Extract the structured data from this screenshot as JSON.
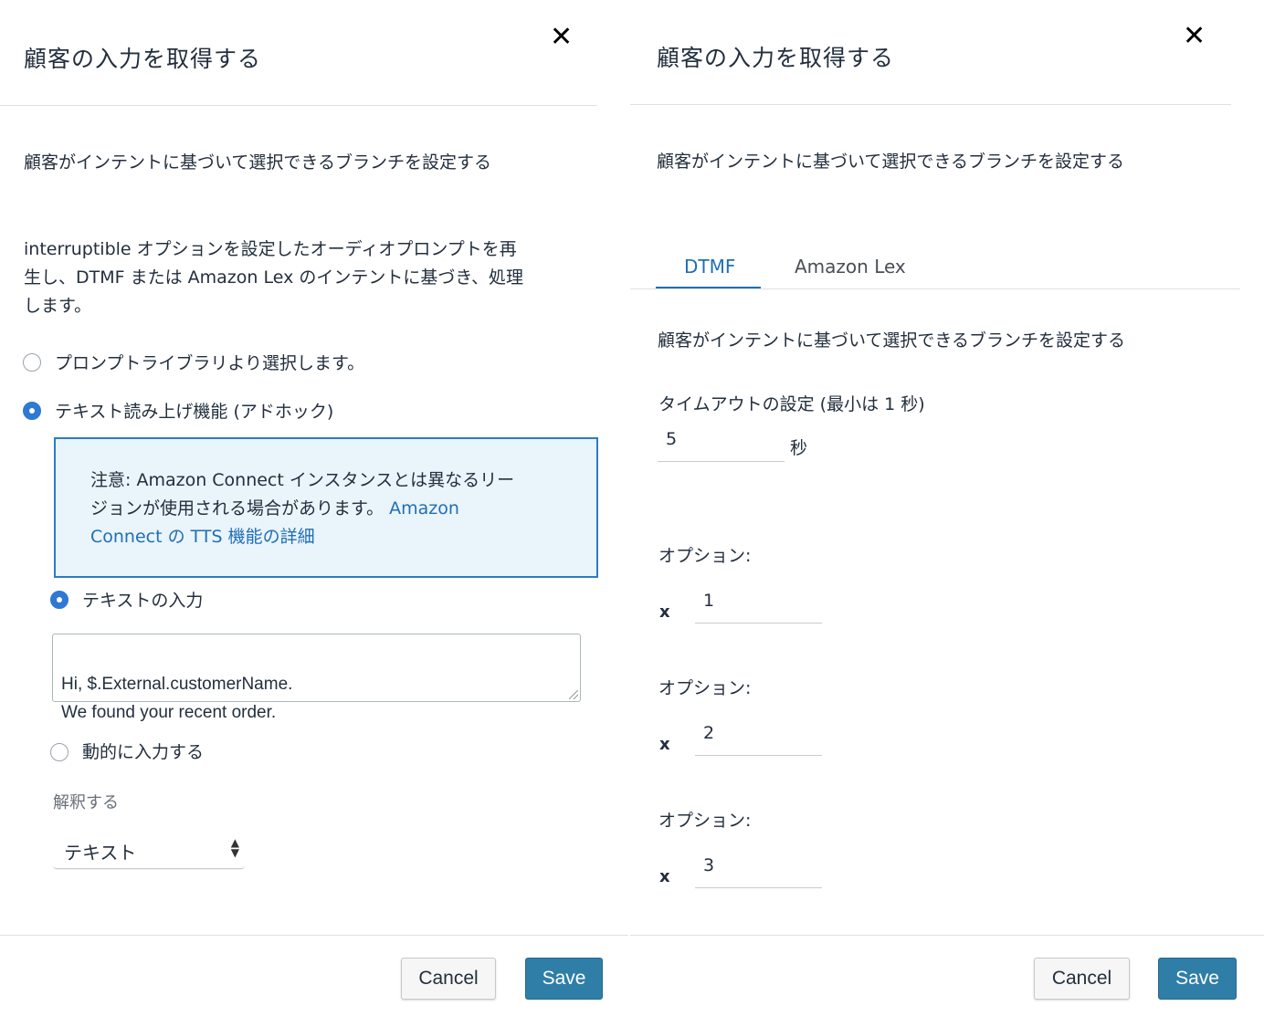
{
  "left": {
    "title": "顧客の入力を取得する",
    "close_label": "✕",
    "subtitle": "顧客がインテントに基づいて選択できるブランチを設定する",
    "description_lines": [
      "interruptible オプションを設定したオーディオプロンプトを再",
      "生し、DTMF または Amazon Lex のインテントに基づき、処理",
      "します。"
    ],
    "radio_library_label": "プロンプトライブラリより選択します。",
    "radio_tts_label": "テキスト読み上げ機能 (アドホック)",
    "notice": {
      "text_line1": "注意: Amazon Connect インスタンスとは異なるリー",
      "text_line2": "ジョンが使用される場合があります。",
      "link_line2": "Amazon",
      "link_line3": "Connect の TTS 機能の詳細"
    },
    "radio_text_input_label": "テキストの入力",
    "textarea_value": "Hi, $.External.customerName.\nWe found your recent order.",
    "radio_dynamic_label": "動的に入力する",
    "interpret_label": "解釈する",
    "interpret_select_value": "テキスト",
    "cancel_label": "Cancel",
    "save_label": "Save"
  },
  "right": {
    "title": "顧客の入力を取得する",
    "close_label": "✕",
    "subtitle": "顧客がインテントに基づいて選択できるブランチを設定する",
    "tabs": [
      {
        "label": "DTMF",
        "active": true
      },
      {
        "label": "Amazon Lex",
        "active": false
      }
    ],
    "tab_subtitle": "顧客がインテントに基づいて選択できるブランチを設定する",
    "timeout_label": "タイムアウトの設定 (最小は 1 秒)",
    "timeout_value": "5",
    "timeout_unit": "秒",
    "options": [
      {
        "label": "オプション:",
        "x": "x",
        "value": "1"
      },
      {
        "label": "オプション:",
        "x": "x",
        "value": "2"
      },
      {
        "label": "オプション:",
        "x": "x",
        "value": "3"
      }
    ],
    "cancel_label": "Cancel",
    "save_label": "Save"
  },
  "colors": {
    "accent_blue": "#1f6fb5",
    "radio_blue": "#2f78d3",
    "notice_bg": "#eaf4fb",
    "save_button": "#2f7ea8"
  }
}
